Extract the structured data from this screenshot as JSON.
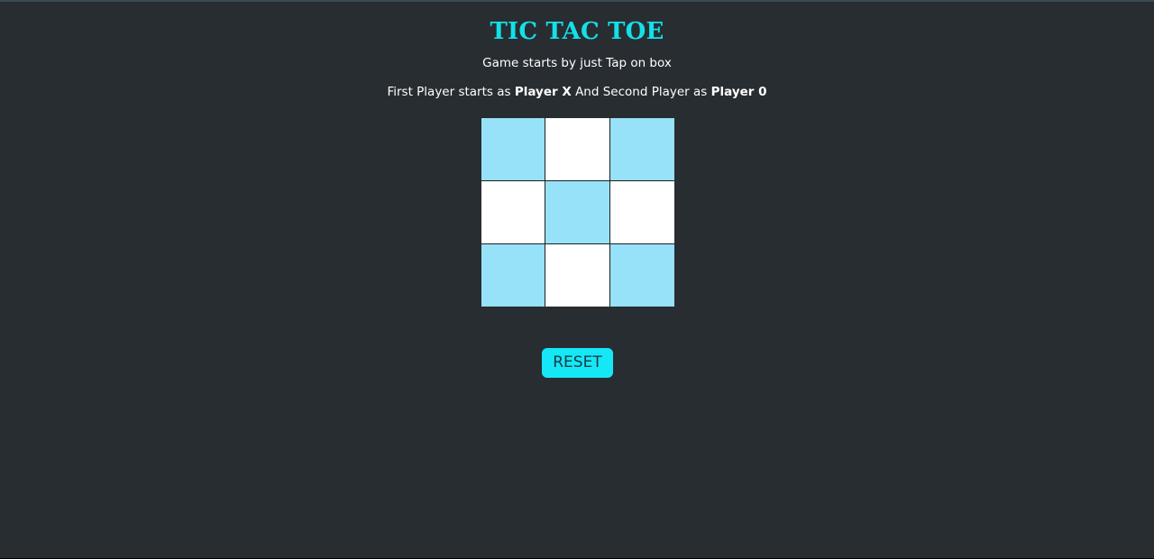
{
  "header": {
    "title": "TIC TAC TOE",
    "subtitle": "Game starts by just Tap on box",
    "players": {
      "prefix": "First Player starts as ",
      "player1": "Player X",
      "middle": " And Second Player as ",
      "player2": "Player 0"
    }
  },
  "board": {
    "cells": [
      "",
      "",
      "",
      "",
      "",
      "",
      "",
      "",
      ""
    ],
    "cell_colors": [
      "#97e2f8",
      "#ffffff",
      "#97e2f8",
      "#ffffff",
      "#97e2f8",
      "#ffffff",
      "#97e2f8",
      "#ffffff",
      "#97e2f8"
    ]
  },
  "controls": {
    "reset_label": "RESET"
  },
  "colors": {
    "background": "#282d32",
    "title": "#13e0e8",
    "button": "#16e7f7",
    "button_text": "#1a3a40",
    "cell_light_blue": "#97e2f8",
    "cell_white": "#ffffff"
  }
}
